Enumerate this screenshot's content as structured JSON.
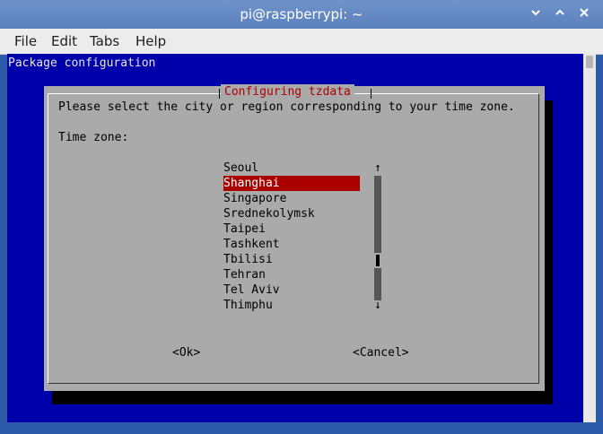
{
  "window": {
    "title": "pi@raspberrypi: ~",
    "controls": [
      "chevron-down-icon",
      "chevron-up-icon",
      "close-icon"
    ]
  },
  "menu": {
    "items": [
      "File",
      "Edit",
      "Tabs",
      "Help"
    ]
  },
  "terminal": {
    "header": "Package configuration",
    "dialog": {
      "title": "Configuring tzdata",
      "prompt": "Please select the city or region corresponding to your time zone.",
      "label": "Time zone:",
      "options": [
        "Seoul",
        "Shanghai",
        "Singapore",
        "Srednekolymsk",
        "Taipei",
        "Tashkent",
        "Tbilisi",
        "Tehran",
        "Tel Aviv",
        "Thimphu"
      ],
      "selected": "Shanghai",
      "scroll_up": "↑",
      "scroll_down": "↓",
      "ok_label": "<Ok>",
      "cancel_label": "<Cancel>"
    }
  },
  "colors": {
    "terminal_bg": "#0000aa",
    "dialog_bg": "#aaaaaa",
    "title_red": "#aa0000",
    "selection_bg": "#aa0000"
  }
}
